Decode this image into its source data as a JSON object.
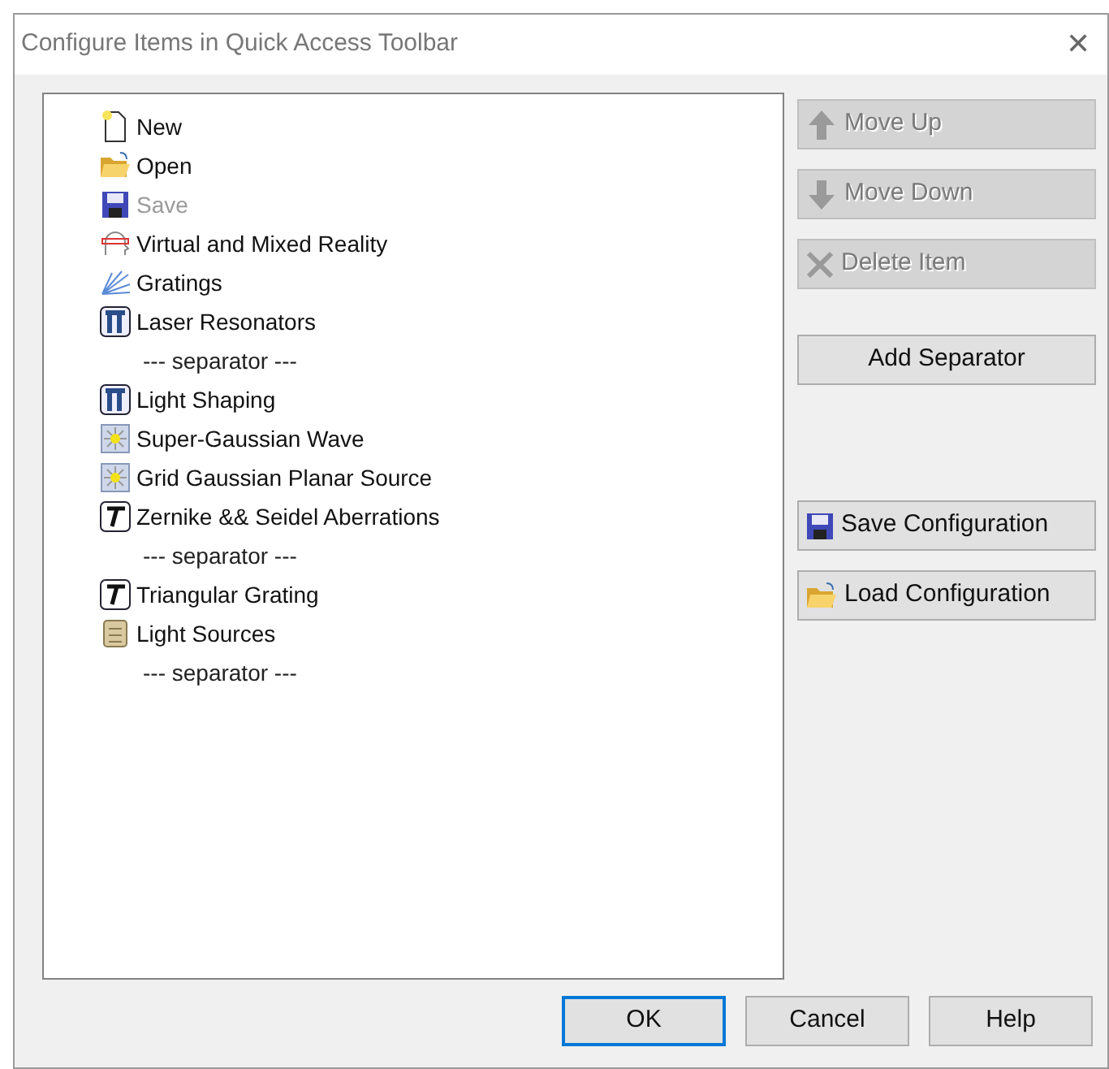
{
  "window": {
    "title": "Configure Items in Quick Access Toolbar",
    "close": "✕"
  },
  "items": [
    {
      "kind": "item",
      "label": "New",
      "disabled": false
    },
    {
      "kind": "item",
      "label": "Open",
      "disabled": false
    },
    {
      "kind": "item",
      "label": "Save",
      "disabled": true
    },
    {
      "kind": "item",
      "label": "Virtual and Mixed Reality",
      "disabled": false
    },
    {
      "kind": "item",
      "label": "Gratings",
      "disabled": false
    },
    {
      "kind": "item",
      "label": "Laser Resonators",
      "disabled": false
    },
    {
      "kind": "separator",
      "label": "--- separator ---"
    },
    {
      "kind": "item",
      "label": "Light Shaping",
      "disabled": false
    },
    {
      "kind": "item",
      "label": "Super-Gaussian Wave",
      "disabled": false
    },
    {
      "kind": "item",
      "label": "Grid Gaussian Planar Source",
      "disabled": false
    },
    {
      "kind": "item",
      "label": "Zernike && Seidel Aberrations",
      "disabled": false
    },
    {
      "kind": "separator",
      "label": "--- separator ---"
    },
    {
      "kind": "item",
      "label": "Triangular Grating",
      "disabled": false
    },
    {
      "kind": "item",
      "label": "Light Sources",
      "disabled": false
    },
    {
      "kind": "separator",
      "label": "--- separator ---"
    }
  ],
  "side_buttons": [
    {
      "label": "Move Up",
      "disabled": true
    },
    {
      "label": "Move Down",
      "disabled": true
    },
    {
      "label": "Delete Item",
      "disabled": true
    },
    {
      "label": "Add Separator",
      "disabled": false
    },
    {
      "label": "Save Configuration",
      "disabled": false
    },
    {
      "label": "Load Configuration",
      "disabled": false
    }
  ],
  "footer_buttons": [
    {
      "label": "OK",
      "focused": true
    },
    {
      "label": "Cancel",
      "focused": false
    },
    {
      "label": "Help",
      "focused": false
    }
  ]
}
